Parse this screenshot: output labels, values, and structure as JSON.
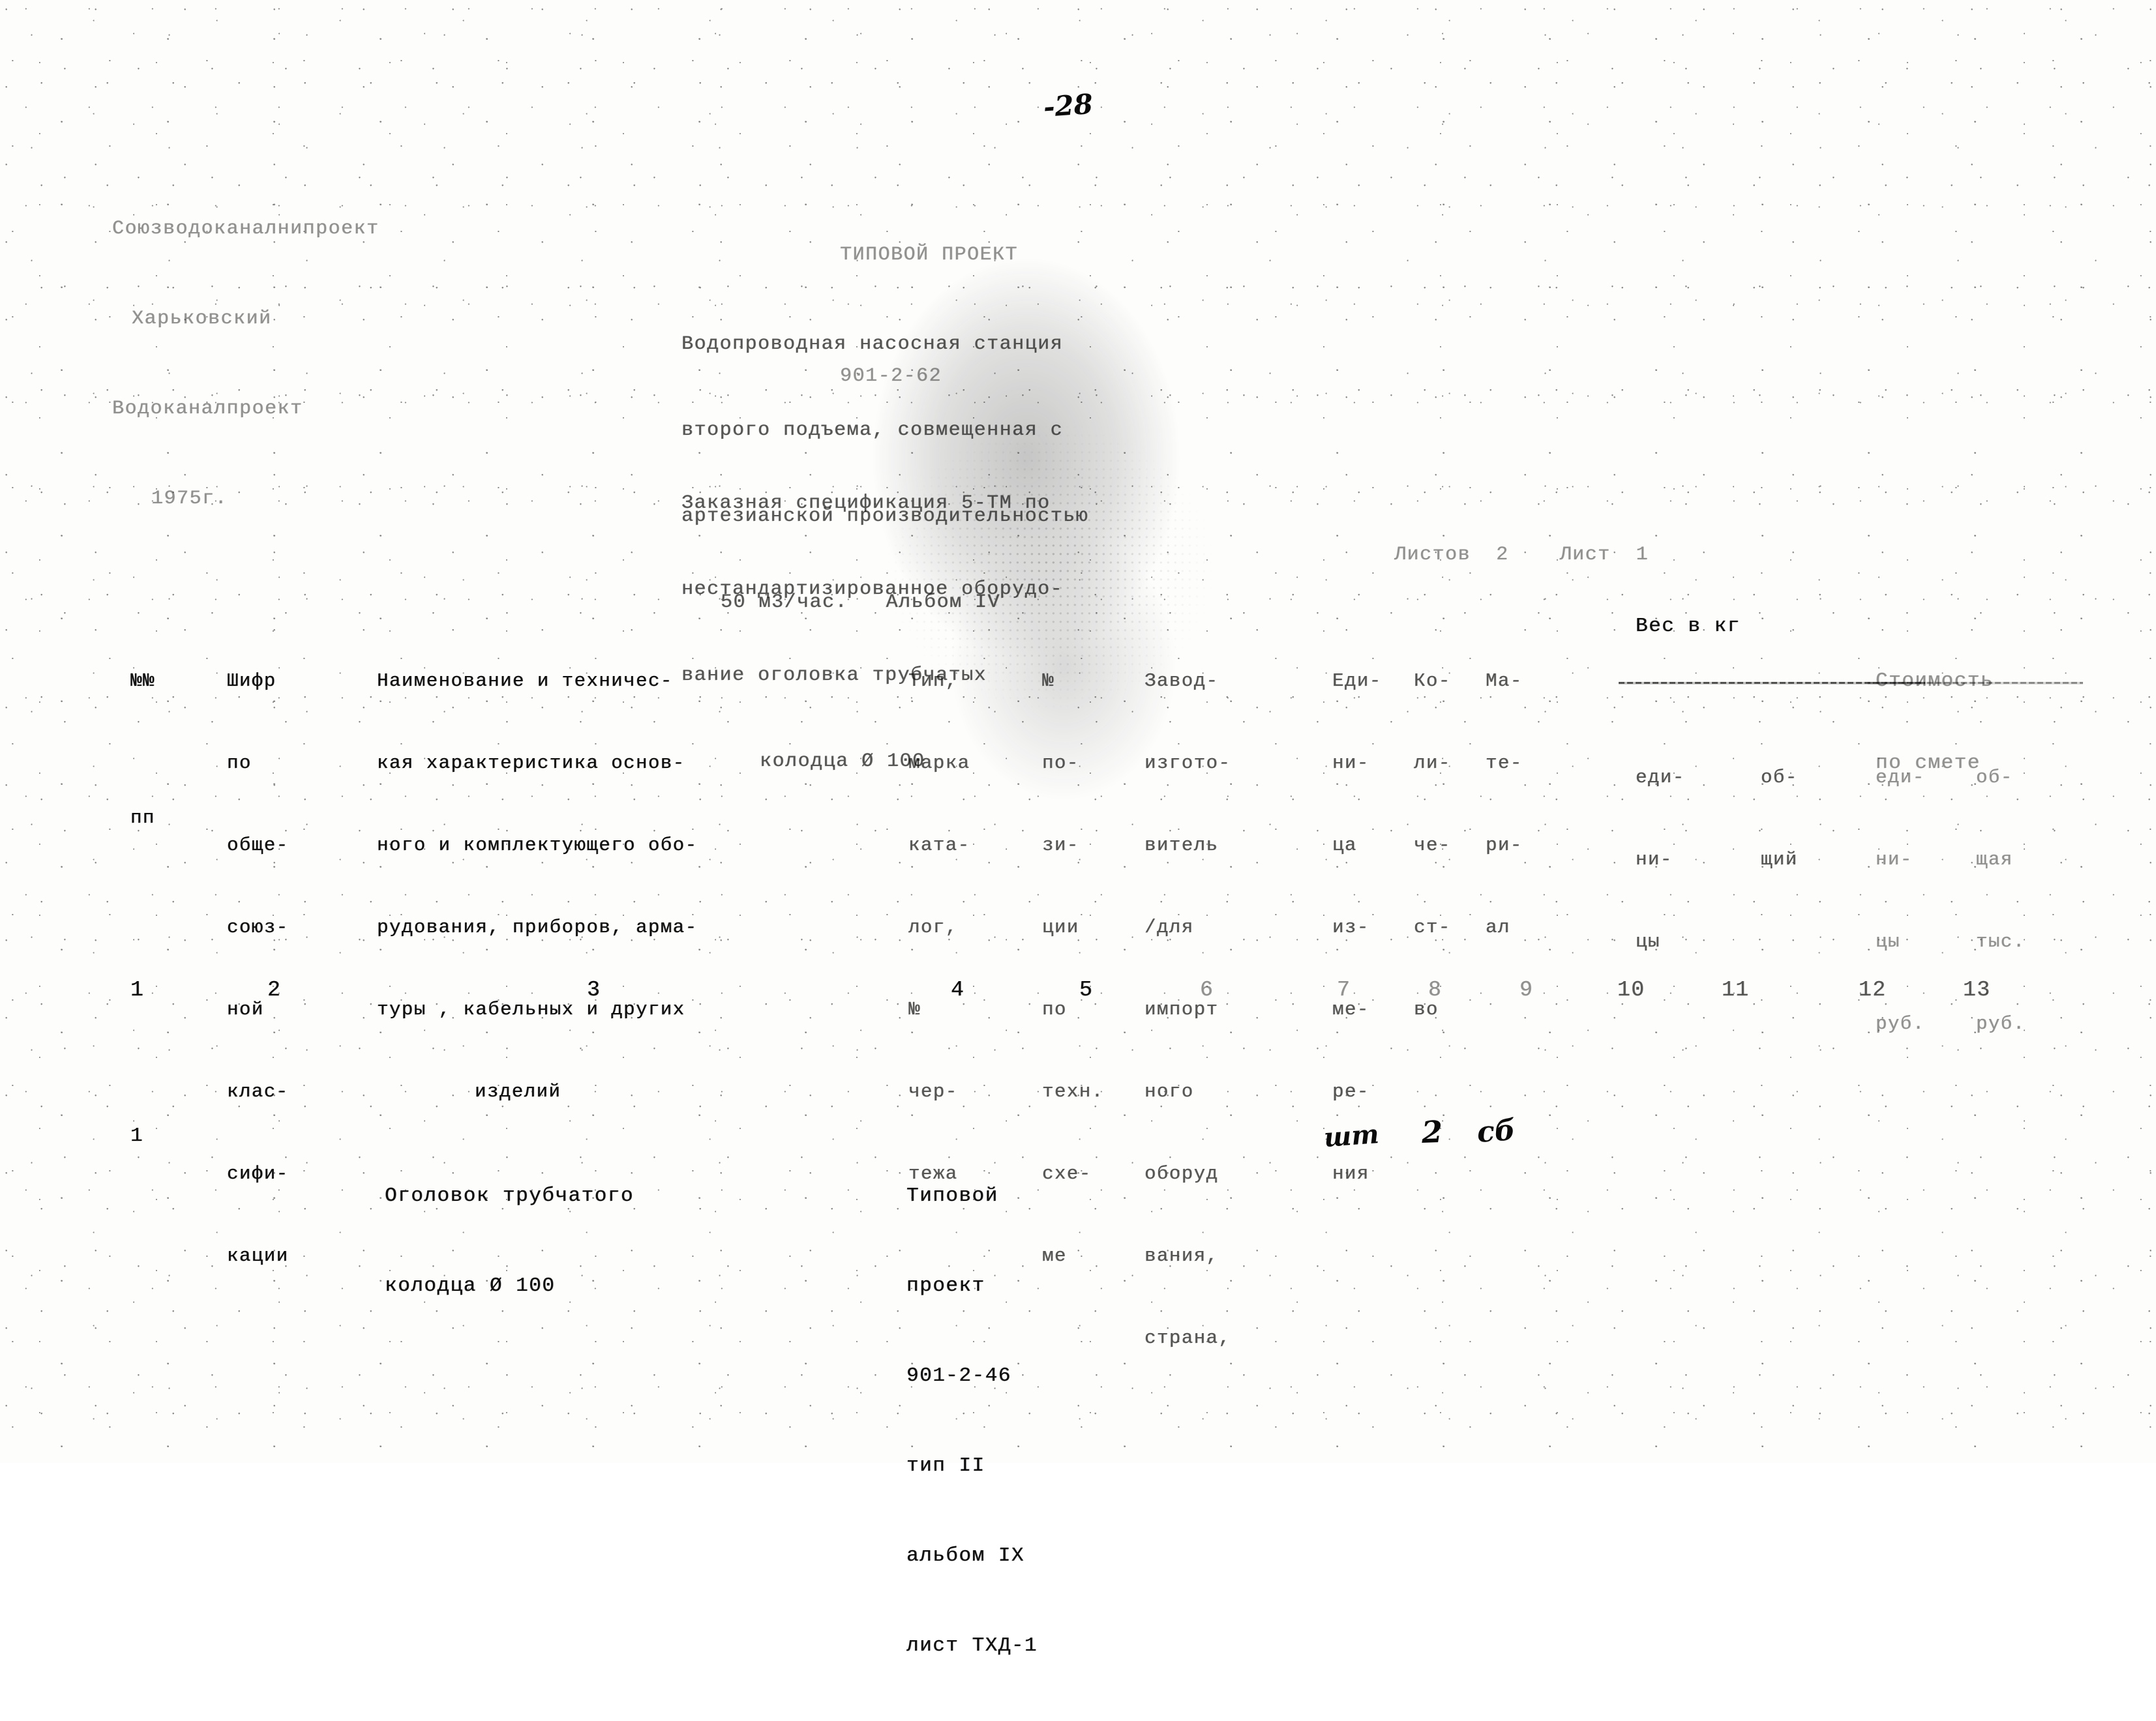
{
  "document": {
    "page_number": "-28",
    "organization": [
      "Союзводоканалнипроект",
      "Харьковский",
      "Водоканалпроект",
      "1975г."
    ],
    "project_heading": [
      "ТИПОВОЙ ПРОЕКТ",
      "901-2-62"
    ],
    "description": [
      "Водопроводная насосная станция",
      "второго подъема, совмещенная с",
      "артезианской производительностью",
      "50 м3/час.   Альбом IV"
    ],
    "specification": [
      "Заказная спецификация 5-ТМ по",
      "нестандартизированное оборудо-",
      "вание оголовка трубчатых",
      "колодца Ø 100"
    ],
    "sheets": {
      "sheets_label": "Листов",
      "sheets_value": "2",
      "sheet_label": "Лист",
      "sheet_value": "1"
    }
  },
  "table": {
    "headers": {
      "col1": [
        "№№",
        "",
        "пп"
      ],
      "col2": [
        "Шифр",
        "по",
        "обще-",
        "союз-",
        "ной",
        "клас-",
        "сифи-",
        "кации"
      ],
      "col3": [
        "Наименование и техничес-",
        "кая характеристика основ-",
        "ного и комплектующего обо-",
        "рудования, приборов, арма-",
        "туры , кабельных и других",
        "изделий"
      ],
      "col4": [
        "Тип,",
        "марка",
        "ката-",
        "лог,",
        "№",
        "чер-",
        "тежа"
      ],
      "col5": [
        "№",
        "по-",
        "зи-",
        "ции",
        "по",
        "техн.",
        "схе-",
        "ме"
      ],
      "col6": [
        "Завод-",
        "изгото-",
        "витель",
        "/для",
        "импорт",
        "ного",
        "оборуд",
        "вания,",
        "страна,"
      ],
      "col7": [
        "Еди-",
        "ни-",
        "ца",
        "из-",
        "ме-",
        "ре-",
        "ния"
      ],
      "col8": [
        "Ко-",
        "ли-",
        "че-",
        "ст-",
        "во"
      ],
      "col9": [
        "Ма-",
        "те-",
        "ри-",
        "ал"
      ],
      "col10_11_group": "Вес в кг",
      "col10": [
        "еди-",
        "ни-",
        "цы"
      ],
      "col11": [
        "об-",
        "щий"
      ],
      "col12_13_group": [
        "Стоимость",
        "по смете"
      ],
      "col12": [
        "еди-",
        "ни-",
        "цы",
        "руб."
      ],
      "col13": [
        "об-",
        "щая",
        "тыс.",
        "руб."
      ]
    },
    "column_numbers": [
      "1",
      "2",
      "3",
      "4",
      "5",
      "6",
      "7",
      "8",
      "9",
      "10",
      "11",
      "12",
      "13"
    ],
    "rows": [
      {
        "num": "1",
        "code": "",
        "name": [
          "Оголовок трубчатого",
          "колодца Ø 100"
        ],
        "type": [
          "Типовой",
          "проект",
          "901-2-46",
          "тип II",
          "альбом IX",
          "лист ТХД-1"
        ],
        "position": "",
        "manufacturer": "",
        "unit": "шт",
        "quantity": "2",
        "material": "сб",
        "weight_unit": "",
        "weight_total": "",
        "cost_unit": "",
        "cost_total": ""
      }
    ]
  },
  "colors": {
    "ink": "#0d0d0d",
    "paper": "#fdfdfc"
  }
}
